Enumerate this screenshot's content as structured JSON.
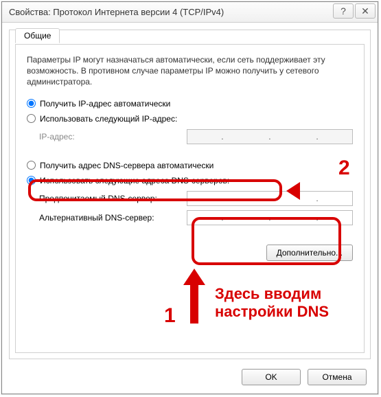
{
  "window": {
    "title": "Свойства: Протокол Интернета версии 4 (TCP/IPv4)"
  },
  "tabs": {
    "general": "Общие"
  },
  "description": "Параметры IP могут назначаться автоматически, если сеть поддерживает эту возможность. В противном случае параметры IP можно получить у сетевого администратора.",
  "ip_group": {
    "auto": "Получить IP-адрес автоматически",
    "manual": "Использовать следующий IP-адрес:",
    "ip_label": "IP-адрес:"
  },
  "dns_group": {
    "auto": "Получить адрес DNS-сервера автоматически",
    "manual": "Использовать следующие адреса DNS-серверов:",
    "pref_label": "Предпочитаемый DNS-сервер:",
    "alt_label": "Альтернативный DNS-сервер:"
  },
  "buttons": {
    "advanced": "Дополнительно...",
    "ok": "OK",
    "cancel": "Отмена"
  },
  "annotations": {
    "num1": "1",
    "num2": "2",
    "note": "Здесь вводим настройки DNS"
  }
}
